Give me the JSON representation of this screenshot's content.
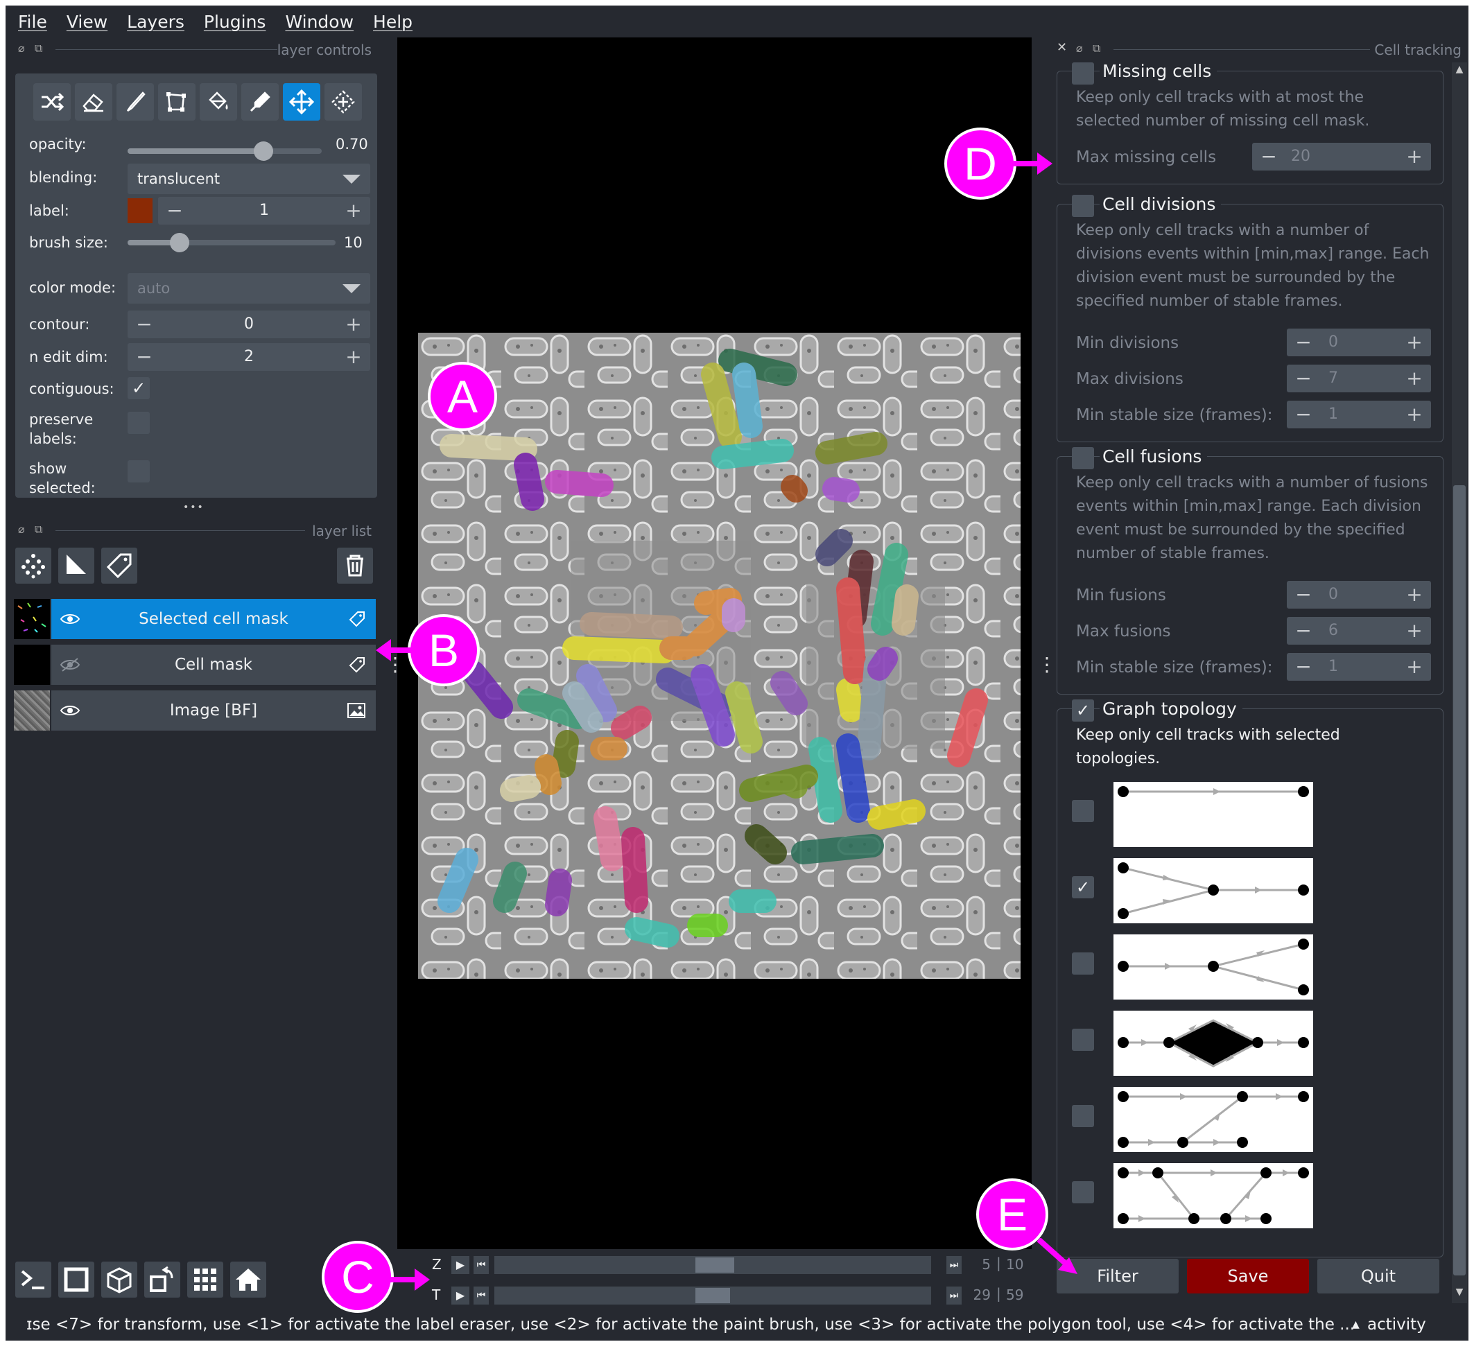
{
  "menu": [
    "File",
    "View",
    "Layers",
    "Plugins",
    "Window",
    "Help"
  ],
  "layer_controls": {
    "title": "layer controls",
    "tools": [
      {
        "name": "shuffle-icon",
        "active": false
      },
      {
        "name": "eraser-icon",
        "active": false
      },
      {
        "name": "paint-brush-icon",
        "active": false
      },
      {
        "name": "polygon-icon",
        "active": false
      },
      {
        "name": "fill-bucket-icon",
        "active": false
      },
      {
        "name": "color-picker-icon",
        "active": false
      },
      {
        "name": "move-icon",
        "active": true
      },
      {
        "name": "transform-icon",
        "active": false
      }
    ],
    "opacity_label": "opacity:",
    "opacity_value": "0.70",
    "opacity_fraction": 0.7,
    "blending_label": "blending:",
    "blending_value": "translucent",
    "label_label": "label:",
    "label_value": "1",
    "label_color": "#8b2a05",
    "brush_label": "brush size:",
    "brush_value": "10",
    "brush_fraction": 0.25,
    "color_mode_label": "color mode:",
    "color_mode_value": "auto",
    "contour_label": "contour:",
    "contour_value": "0",
    "n_edit_dim_label": "n edit dim:",
    "n_edit_dim_value": "2",
    "contiguous_label": "contiguous:",
    "contiguous_checked": true,
    "preserve_label": "preserve labels:",
    "preserve_checked": false,
    "show_selected_label": "show selected:",
    "show_selected_checked": false,
    "ellipsis": "•••"
  },
  "layer_list": {
    "title": "layer list",
    "layers": [
      {
        "name": "Selected cell mask",
        "selected": true,
        "visible": true,
        "type_icon": "label-tag-icon"
      },
      {
        "name": "Cell mask",
        "selected": false,
        "visible": false,
        "type_icon": "label-tag-icon"
      },
      {
        "name": "Image [BF]",
        "selected": false,
        "visible": true,
        "type_icon": "image-icon"
      }
    ]
  },
  "dims": [
    {
      "axis": "Z",
      "current": "5",
      "total": "10",
      "fraction": 0.5
    },
    {
      "axis": "T",
      "current": "29",
      "total": "59",
      "fraction": 0.5
    }
  ],
  "cell_tracking": {
    "title": "Cell tracking",
    "missing": {
      "title": "Missing cells",
      "checked": false,
      "desc": "Keep only cell tracks with at most the selected number of missing cell mask.",
      "rows": [
        {
          "label": "Max missing cells",
          "value": "20"
        }
      ]
    },
    "divisions": {
      "title": "Cell divisions",
      "checked": false,
      "desc": "Keep only cell tracks with a number of divisions events within [min,max] range. Each division event must be surrounded by the specified number of stable frames.",
      "rows": [
        {
          "label": "Min divisions",
          "value": "0"
        },
        {
          "label": "Max divisions",
          "value": "7"
        },
        {
          "label": "Min stable size (frames):",
          "value": "1"
        }
      ]
    },
    "fusions": {
      "title": "Cell fusions",
      "checked": false,
      "desc": "Keep only cell tracks with a number of fusions events within [min,max] range. Each division event must be surrounded by the specified number of stable frames.",
      "rows": [
        {
          "label": "Min fusions",
          "value": "0"
        },
        {
          "label": "Max fusions",
          "value": "6"
        },
        {
          "label": "Min stable size (frames):",
          "value": "1"
        }
      ]
    },
    "topology": {
      "title": "Graph topology",
      "checked": true,
      "desc": "Keep only cell tracks with selected topologies.",
      "options": [
        {
          "checked": false
        },
        {
          "checked": true
        },
        {
          "checked": false
        },
        {
          "checked": false
        },
        {
          "checked": false
        },
        {
          "checked": false
        }
      ]
    },
    "buttons": {
      "filter": "Filter",
      "save": "Save",
      "quit": "Quit",
      "save_color": "#8b0000"
    }
  },
  "markers": [
    "A",
    "B",
    "C",
    "D",
    "E"
  ],
  "marker_color": "#ff00ff",
  "status": {
    "text": "ɪse <7> for transform, use <1> for activate the label eraser, use <2> for activate the paint brush, use <3> for activate the polygon tool, use <4> for activate the ...",
    "activity": "activity"
  }
}
